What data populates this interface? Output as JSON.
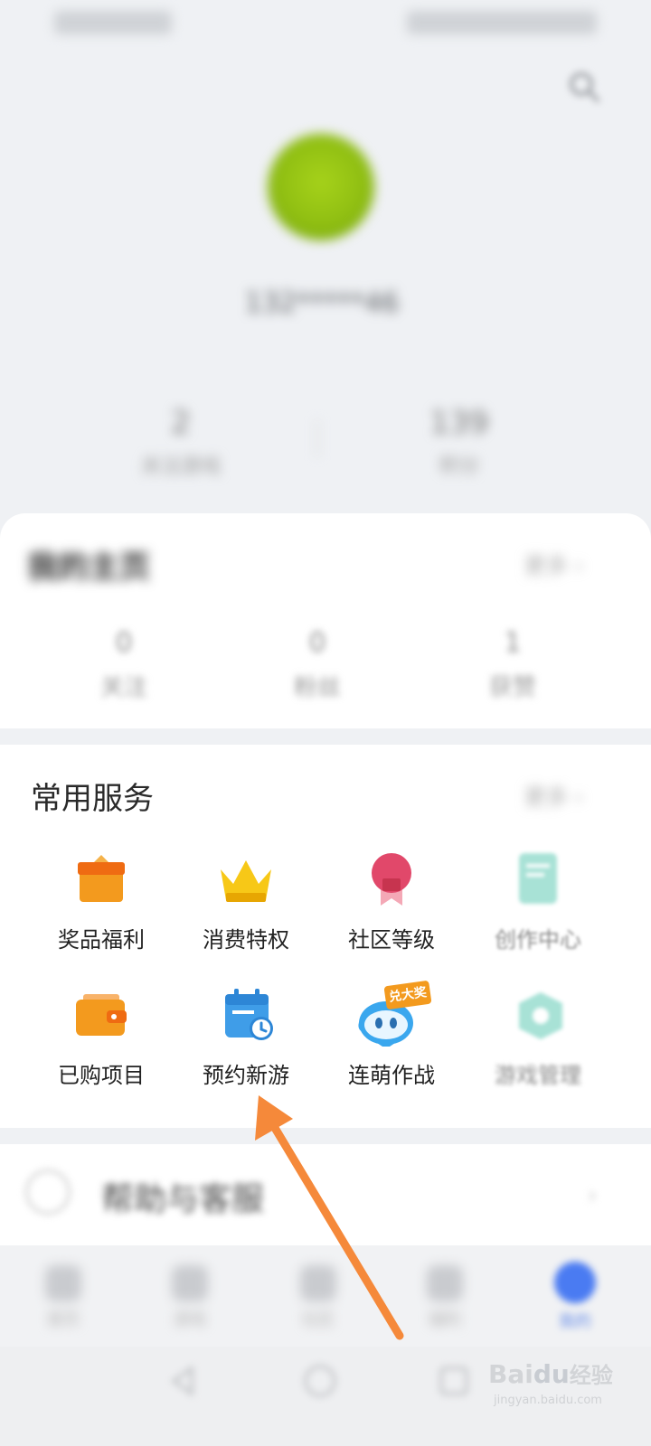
{
  "profile": {
    "username": "132*****46",
    "stats": [
      {
        "value": "2",
        "label": "关注游戏"
      },
      {
        "value": "139",
        "label": "积分"
      }
    ]
  },
  "my_assets": {
    "title": "我的主页",
    "more": "更多 ›",
    "items": [
      {
        "value": "0",
        "label": "关注"
      },
      {
        "value": "0",
        "label": "粉丝"
      },
      {
        "value": "1",
        "label": "获赞"
      }
    ]
  },
  "services": {
    "title": "常用服务",
    "more": "更多 ›",
    "row1": [
      {
        "label": "奖品福利",
        "icon": "gift-icon"
      },
      {
        "label": "消费特权",
        "icon": "crown-icon"
      },
      {
        "label": "社区等级",
        "icon": "medal-icon"
      },
      {
        "label": "创作中心",
        "icon": "document-icon"
      }
    ],
    "row2": [
      {
        "label": "已购项目",
        "icon": "wallet-icon"
      },
      {
        "label": "预约新游",
        "icon": "calendar-clock-icon"
      },
      {
        "label": "连萌作战",
        "icon": "mascot-icon",
        "badge": "兑大奖"
      },
      {
        "label": "游戏管理",
        "icon": "game-icon"
      }
    ]
  },
  "help": {
    "label": "帮助与客服"
  },
  "bottom_nav": [
    {
      "label": "首页"
    },
    {
      "label": "游戏"
    },
    {
      "label": "社区"
    },
    {
      "label": "福利"
    },
    {
      "label": "我的"
    }
  ],
  "watermark": {
    "brand": "Bai",
    "brand_paw": "du",
    "suffix": "经验",
    "url": "jingyan.baidu.com"
  },
  "colors": {
    "accent_blue": "#4a7bf2",
    "arrow_orange": "#f5893a",
    "gift_orange": "#f39a1e",
    "crown_yellow": "#f2b705",
    "medal_red": "#e1486a",
    "calendar_blue": "#3f9de8"
  }
}
